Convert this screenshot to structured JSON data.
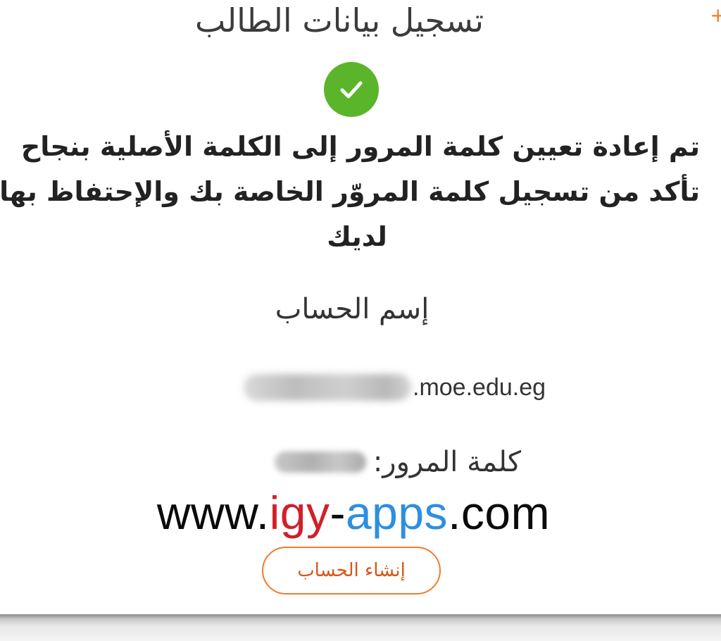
{
  "dialog": {
    "title": "تسجيل بيانات الطالب",
    "close_symbol": "+",
    "message_lines": [
      "تم إعادة تعيين كلمة المرور إلى الكلمة الأصلية بنجاح",
      "تأكد من تسجيل كلمة المروّر الخاصة بك والإحتفاظ بها",
      "لديك"
    ],
    "account_label": "إسم الحساب",
    "account_domain": ".moe.edu.eg",
    "password_label": "كلمة المرور:",
    "create_account_button": "إنشاء الحساب"
  },
  "watermark": {
    "prefix": "www.",
    "part_red": "igy",
    "dash": "-",
    "part_blue": "apps",
    "suffix": ".com"
  },
  "icons": {
    "success": "check-circle-icon",
    "close": "close-icon"
  },
  "colors": {
    "accent": "#f07c2c",
    "success": "#5ab52a",
    "watermark_red": "#d0202a",
    "watermark_blue": "#2d8fe0"
  }
}
